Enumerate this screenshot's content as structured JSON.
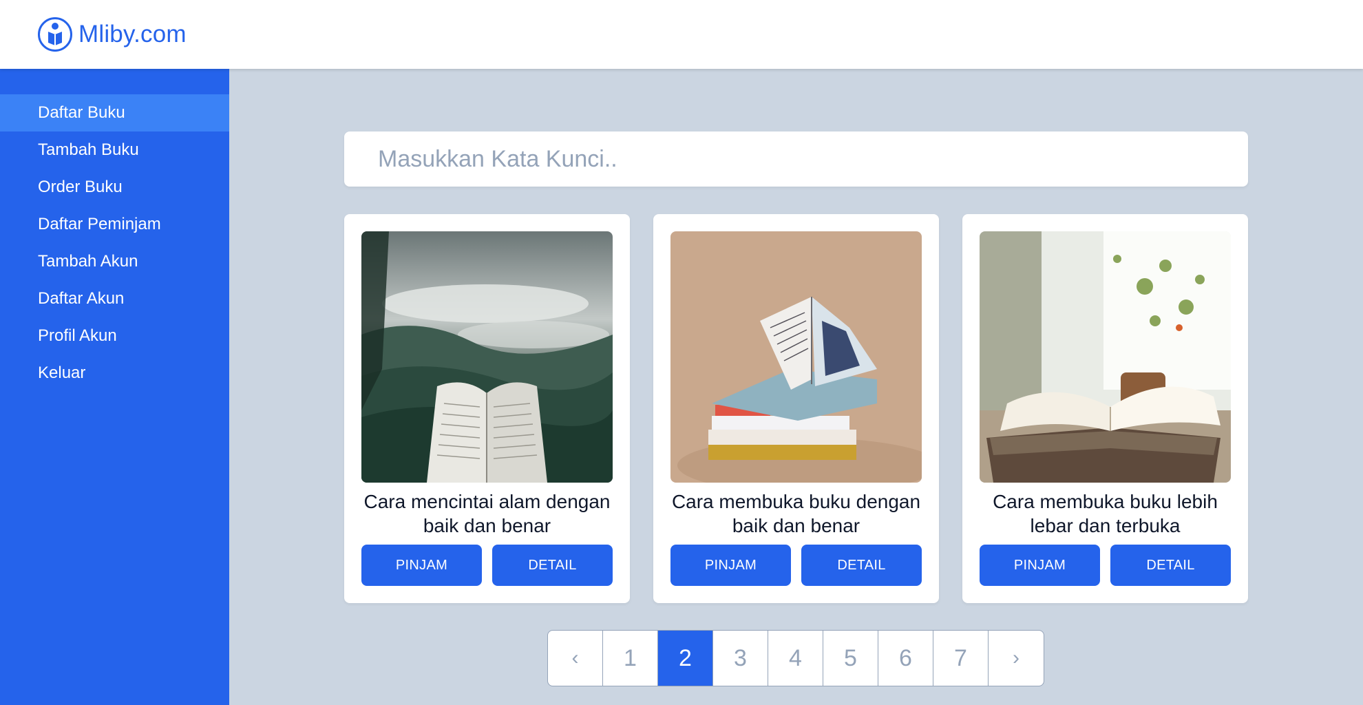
{
  "header": {
    "brand": "Mliby.com",
    "logo_icon": "person-reading-logo-icon",
    "brand_color": "#2563eb"
  },
  "sidebar": {
    "accent": "#2563eb",
    "active_bg": "#3b82f6",
    "items": [
      {
        "label": "Daftar Buku",
        "active": true
      },
      {
        "label": "Tambah Buku",
        "active": false
      },
      {
        "label": "Order Buku",
        "active": false
      },
      {
        "label": "Daftar Peminjam",
        "active": false
      },
      {
        "label": "Tambah Akun",
        "active": false
      },
      {
        "label": "Daftar Akun",
        "active": false
      },
      {
        "label": "Profil Akun",
        "active": false
      },
      {
        "label": "Keluar",
        "active": false
      }
    ]
  },
  "search": {
    "placeholder": "Masukkan Kata Kunci..",
    "value": ""
  },
  "books": [
    {
      "title": "Cara mencintai alam dengan baik dan benar",
      "image": "open-book-misty-forest",
      "pinjam_label": "PINJAM",
      "detail_label": "DETAIL"
    },
    {
      "title": "Cara membuka buku dengan baik dan benar",
      "image": "open-book-stack-beige",
      "pinjam_label": "PINJAM",
      "detail_label": "DETAIL"
    },
    {
      "title": "Cara membuka buku lebih lebar dan terbuka",
      "image": "open-book-window-plant",
      "pinjam_label": "PINJAM",
      "detail_label": "DETAIL"
    }
  ],
  "pagination": {
    "prev": "‹",
    "next": "›",
    "pages": [
      "1",
      "2",
      "3",
      "4",
      "5",
      "6",
      "7"
    ],
    "current": "2"
  }
}
